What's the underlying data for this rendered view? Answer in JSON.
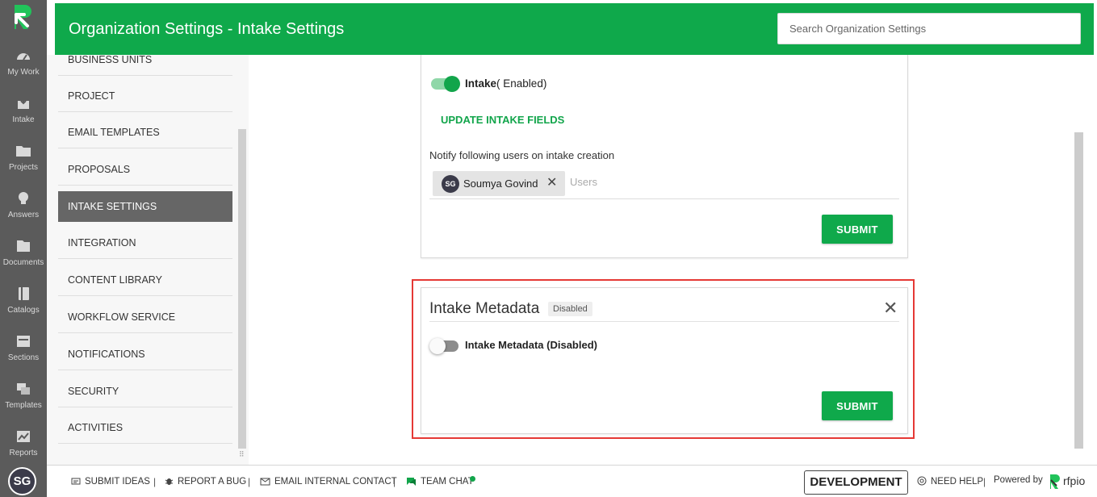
{
  "rail": {
    "items": [
      {
        "label": "My Work",
        "icon": "gauge-icon"
      },
      {
        "label": "Intake",
        "icon": "inbox-download-icon"
      },
      {
        "label": "Projects",
        "icon": "folder-icon"
      },
      {
        "label": "Answers",
        "icon": "lightbulb-icon"
      },
      {
        "label": "Documents",
        "icon": "documents-icon"
      },
      {
        "label": "Catalogs",
        "icon": "catalog-icon"
      },
      {
        "label": "Sections",
        "icon": "sections-icon"
      },
      {
        "label": "Templates",
        "icon": "templates-icon"
      },
      {
        "label": "Reports",
        "icon": "chart-icon"
      }
    ],
    "avatar_initials": "SG"
  },
  "header": {
    "title": "Organization Settings - Intake Settings",
    "search_placeholder": "Search Organization Settings"
  },
  "nav": {
    "items": [
      "BUSINESS UNITS",
      "PROJECT",
      "EMAIL TEMPLATES",
      "PROPOSALS",
      "INTAKE SETTINGS",
      "INTEGRATION",
      "CONTENT LIBRARY",
      "WORKFLOW SERVICE",
      "NOTIFICATIONS",
      "SECURITY",
      "ACTIVITIES"
    ],
    "active": "INTAKE SETTINGS"
  },
  "intake": {
    "toggle_label": "Intake",
    "toggle_state": "( Enabled)",
    "enabled": true,
    "update_link": "UPDATE INTAKE FIELDS",
    "notify_label": "Notify following users on intake creation",
    "chip": {
      "initials": "SG",
      "name": "Soumya Govind",
      "remove": "✕"
    },
    "users_placeholder": "Users",
    "submit": "SUBMIT"
  },
  "metadata": {
    "title": "Intake Metadata",
    "badge": "Disabled",
    "close": "✕",
    "toggle_label": "Intake Metadata (Disabled)",
    "enabled": false,
    "submit": "SUBMIT"
  },
  "footer": {
    "submit_ideas": "SUBMIT IDEAS",
    "report_bug": "REPORT A BUG",
    "email_contact": "EMAIL INTERNAL CONTACT",
    "team_chat": "TEAM CHAT",
    "separator": "|",
    "environment": "DEVELOPMENT",
    "need_help": "NEED HELP",
    "powered_by": "Powered by",
    "brand": "rfpio"
  },
  "colors": {
    "brand_green": "#0fa94b",
    "rail_gray": "#5b5b5b",
    "highlight_red": "#e53935"
  }
}
